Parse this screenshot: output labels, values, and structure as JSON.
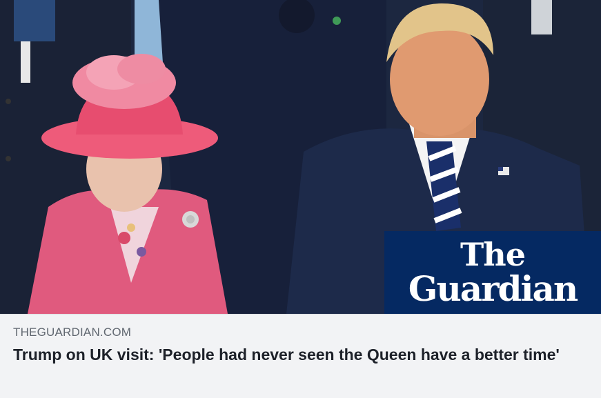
{
  "link_card": {
    "image": {
      "brand_logo": {
        "line1": "The",
        "line2": "Guardian",
        "background": "#052962"
      }
    },
    "domain": "THEGUARDIAN.COM",
    "headline": "Trump on UK visit: 'People had never seen the Queen have a better time'"
  },
  "colors": {
    "card_background": "#f2f3f5",
    "domain_text": "#606770",
    "headline_text": "#1d2129"
  }
}
